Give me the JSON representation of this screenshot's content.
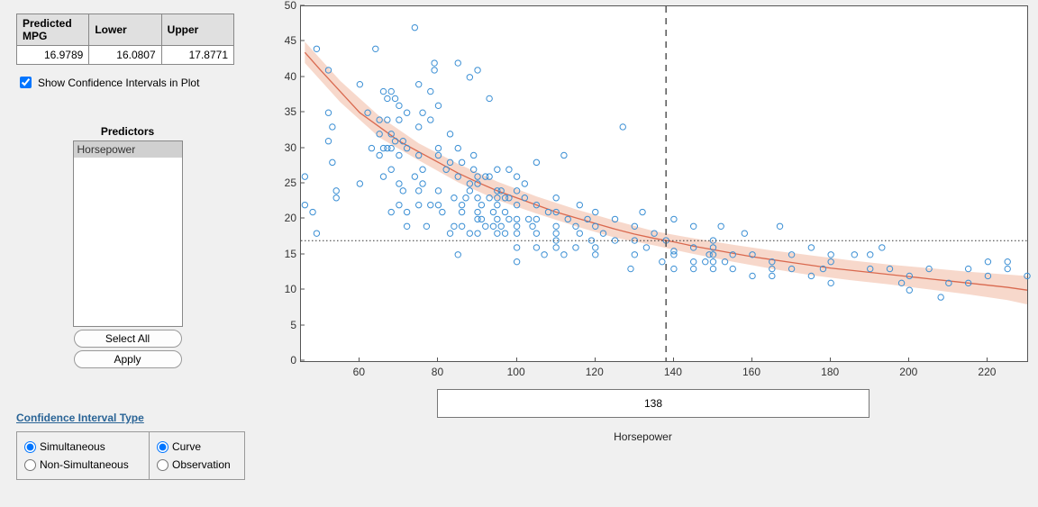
{
  "table": {
    "headers": [
      "Predicted MPG",
      "Lower",
      "Upper"
    ],
    "values": [
      "16.9789",
      "16.0807",
      "17.8771"
    ]
  },
  "checkbox": {
    "label": "Show Confidence Intervals in Plot",
    "checked": true
  },
  "predictors": {
    "title": "Predictors",
    "items": [
      "Horsepower"
    ],
    "selected": 0,
    "select_all": "Select All",
    "apply": "Apply"
  },
  "ci": {
    "link": "Confidence Interval Type",
    "col1": [
      {
        "label": "Simultaneous",
        "checked": true
      },
      {
        "label": "Non-Simultaneous",
        "checked": false
      }
    ],
    "col2": [
      {
        "label": "Curve",
        "checked": true
      },
      {
        "label": "Observation",
        "checked": false
      }
    ]
  },
  "slider": {
    "value": "138",
    "axis_label": "Horsepower"
  },
  "chart_data": {
    "type": "scatter",
    "xlabel": "Horsepower",
    "ylabel": "",
    "xlim": [
      45,
      230
    ],
    "ylim": [
      0,
      50
    ],
    "xticks": [
      60,
      80,
      100,
      120,
      140,
      160,
      180,
      200,
      220
    ],
    "yticks": [
      0,
      5,
      10,
      15,
      20,
      25,
      30,
      35,
      40,
      45,
      50
    ],
    "vertical_line_x": 138,
    "horizontal_line_y": 16.98,
    "fit_curve": [
      [
        46,
        43.5
      ],
      [
        50,
        41
      ],
      [
        55,
        38
      ],
      [
        60,
        35
      ],
      [
        65,
        33
      ],
      [
        70,
        31
      ],
      [
        75,
        29.5
      ],
      [
        80,
        28
      ],
      [
        85,
        26.5
      ],
      [
        90,
        25.2
      ],
      [
        95,
        24
      ],
      [
        100,
        23
      ],
      [
        105,
        22
      ],
      [
        110,
        21
      ],
      [
        115,
        20.2
      ],
      [
        120,
        19.4
      ],
      [
        125,
        18.6
      ],
      [
        130,
        17.9
      ],
      [
        135,
        17.3
      ],
      [
        140,
        16.8
      ],
      [
        145,
        16.2
      ],
      [
        150,
        15.7
      ],
      [
        155,
        15.2
      ],
      [
        160,
        14.7
      ],
      [
        165,
        14.3
      ],
      [
        170,
        13.9
      ],
      [
        175,
        13.5
      ],
      [
        180,
        13.1
      ],
      [
        185,
        12.8
      ],
      [
        190,
        12.5
      ],
      [
        195,
        12.2
      ],
      [
        200,
        11.9
      ],
      [
        205,
        11.6
      ],
      [
        210,
        11.3
      ],
      [
        215,
        11.0
      ],
      [
        220,
        10.7
      ],
      [
        225,
        10.4
      ],
      [
        230,
        10.0
      ]
    ],
    "ci_upper": [
      [
        46,
        45
      ],
      [
        55,
        39.5
      ],
      [
        65,
        34.5
      ],
      [
        75,
        30.7
      ],
      [
        85,
        27.8
      ],
      [
        95,
        25.3
      ],
      [
        105,
        23.2
      ],
      [
        115,
        21.4
      ],
      [
        125,
        19.8
      ],
      [
        135,
        18.3
      ],
      [
        145,
        17.3
      ],
      [
        155,
        16.4
      ],
      [
        165,
        15.6
      ],
      [
        175,
        14.9
      ],
      [
        185,
        14.2
      ],
      [
        195,
        13.6
      ],
      [
        205,
        13.1
      ],
      [
        215,
        12.6
      ],
      [
        225,
        12.2
      ],
      [
        230,
        12.0
      ]
    ],
    "ci_lower": [
      [
        46,
        42
      ],
      [
        55,
        36.5
      ],
      [
        65,
        31.5
      ],
      [
        75,
        28.3
      ],
      [
        85,
        25.2
      ],
      [
        95,
        22.7
      ],
      [
        105,
        20.8
      ],
      [
        115,
        19.0
      ],
      [
        125,
        17.4
      ],
      [
        135,
        16.3
      ],
      [
        145,
        15.1
      ],
      [
        155,
        14.0
      ],
      [
        165,
        13.0
      ],
      [
        175,
        12.1
      ],
      [
        185,
        11.4
      ],
      [
        195,
        10.8
      ],
      [
        205,
        10.1
      ],
      [
        215,
        9.4
      ],
      [
        225,
        8.6
      ],
      [
        230,
        8.0
      ]
    ],
    "points": [
      [
        46,
        26
      ],
      [
        46,
        22
      ],
      [
        48,
        21
      ],
      [
        49,
        18
      ],
      [
        49,
        44
      ],
      [
        52,
        35
      ],
      [
        52,
        31
      ],
      [
        52,
        41
      ],
      [
        53,
        28
      ],
      [
        53,
        33
      ],
      [
        54,
        24
      ],
      [
        54,
        23
      ],
      [
        60,
        25
      ],
      [
        60,
        39
      ],
      [
        62,
        35
      ],
      [
        63,
        30
      ],
      [
        64,
        44
      ],
      [
        65,
        29
      ],
      [
        65,
        34
      ],
      [
        65,
        32
      ],
      [
        66,
        30
      ],
      [
        66,
        38
      ],
      [
        66,
        26
      ],
      [
        67,
        30
      ],
      [
        67,
        34
      ],
      [
        67,
        37
      ],
      [
        68,
        21
      ],
      [
        68,
        38
      ],
      [
        68,
        27
      ],
      [
        68,
        32
      ],
      [
        68,
        30
      ],
      [
        69,
        37
      ],
      [
        69,
        31
      ],
      [
        70,
        25
      ],
      [
        70,
        36
      ],
      [
        70,
        29
      ],
      [
        70,
        22
      ],
      [
        70,
        34
      ],
      [
        71,
        24
      ],
      [
        71,
        31
      ],
      [
        72,
        19
      ],
      [
        72,
        21
      ],
      [
        72,
        35
      ],
      [
        72,
        30
      ],
      [
        74,
        26
      ],
      [
        74,
        47
      ],
      [
        75,
        24
      ],
      [
        75,
        22
      ],
      [
        75,
        39
      ],
      [
        75,
        33
      ],
      [
        75,
        29
      ],
      [
        76,
        25
      ],
      [
        76,
        35
      ],
      [
        76,
        27
      ],
      [
        77,
        19
      ],
      [
        78,
        38
      ],
      [
        78,
        22
      ],
      [
        78,
        34
      ],
      [
        79,
        41
      ],
      [
        79,
        42
      ],
      [
        80,
        22
      ],
      [
        80,
        30
      ],
      [
        80,
        29
      ],
      [
        80,
        24
      ],
      [
        80,
        36
      ],
      [
        81,
        21
      ],
      [
        82,
        27
      ],
      [
        83,
        32
      ],
      [
        83,
        18
      ],
      [
        83,
        28
      ],
      [
        84,
        23
      ],
      [
        84,
        19
      ],
      [
        85,
        26
      ],
      [
        85,
        42
      ],
      [
        85,
        30
      ],
      [
        85,
        15
      ],
      [
        86,
        28
      ],
      [
        86,
        19
      ],
      [
        86,
        21
      ],
      [
        86,
        22
      ],
      [
        87,
        23
      ],
      [
        88,
        24
      ],
      [
        88,
        18
      ],
      [
        88,
        40
      ],
      [
        88,
        25
      ],
      [
        89,
        29
      ],
      [
        89,
        27
      ],
      [
        90,
        21
      ],
      [
        90,
        18
      ],
      [
        90,
        41
      ],
      [
        90,
        26
      ],
      [
        90,
        25
      ],
      [
        90,
        20
      ],
      [
        90,
        23
      ],
      [
        91,
        22
      ],
      [
        91,
        20
      ],
      [
        92,
        26
      ],
      [
        92,
        19
      ],
      [
        93,
        26
      ],
      [
        93,
        23
      ],
      [
        93,
        37
      ],
      [
        94,
        21
      ],
      [
        94,
        19
      ],
      [
        95,
        23
      ],
      [
        95,
        27
      ],
      [
        95,
        20
      ],
      [
        95,
        22
      ],
      [
        95,
        24
      ],
      [
        95,
        18
      ],
      [
        96,
        19
      ],
      [
        96,
        24
      ],
      [
        97,
        18
      ],
      [
        97,
        23
      ],
      [
        97,
        21
      ],
      [
        98,
        27
      ],
      [
        98,
        20
      ],
      [
        98,
        23
      ],
      [
        100,
        19
      ],
      [
        100,
        24
      ],
      [
        100,
        22
      ],
      [
        100,
        20
      ],
      [
        100,
        18
      ],
      [
        100,
        14
      ],
      [
        100,
        16
      ],
      [
        100,
        26
      ],
      [
        102,
        25
      ],
      [
        102,
        23
      ],
      [
        103,
        20
      ],
      [
        104,
        19
      ],
      [
        105,
        18
      ],
      [
        105,
        22
      ],
      [
        105,
        28
      ],
      [
        105,
        20
      ],
      [
        105,
        16
      ],
      [
        107,
        15
      ],
      [
        108,
        21
      ],
      [
        110,
        19
      ],
      [
        110,
        21
      ],
      [
        110,
        17
      ],
      [
        110,
        23
      ],
      [
        110,
        18
      ],
      [
        110,
        16
      ],
      [
        112,
        15
      ],
      [
        112,
        29
      ],
      [
        113,
        20
      ],
      [
        115,
        19
      ],
      [
        115,
        16
      ],
      [
        116,
        18
      ],
      [
        116,
        22
      ],
      [
        118,
        20
      ],
      [
        119,
        17
      ],
      [
        120,
        15
      ],
      [
        120,
        16
      ],
      [
        120,
        21
      ],
      [
        120,
        19
      ],
      [
        122,
        18
      ],
      [
        125,
        17
      ],
      [
        125,
        20
      ],
      [
        127,
        33
      ],
      [
        129,
        13
      ],
      [
        130,
        15
      ],
      [
        130,
        17
      ],
      [
        130,
        19
      ],
      [
        132,
        21
      ],
      [
        133,
        16
      ],
      [
        135,
        18
      ],
      [
        137,
        14
      ],
      [
        138,
        17
      ],
      [
        140,
        15
      ],
      [
        140,
        20
      ],
      [
        140,
        13
      ],
      [
        140,
        15.5
      ],
      [
        145,
        13
      ],
      [
        145,
        16
      ],
      [
        145,
        19
      ],
      [
        145,
        14
      ],
      [
        148,
        14
      ],
      [
        149,
        15
      ],
      [
        150,
        13
      ],
      [
        150,
        14
      ],
      [
        150,
        17
      ],
      [
        150,
        15
      ],
      [
        150,
        16
      ],
      [
        152,
        19
      ],
      [
        153,
        14
      ],
      [
        155,
        15
      ],
      [
        155,
        13
      ],
      [
        158,
        18
      ],
      [
        160,
        12
      ],
      [
        160,
        15
      ],
      [
        165,
        14
      ],
      [
        165,
        13
      ],
      [
        165,
        12
      ],
      [
        167,
        19
      ],
      [
        170,
        15
      ],
      [
        170,
        13
      ],
      [
        175,
        12
      ],
      [
        175,
        16
      ],
      [
        178,
        13
      ],
      [
        180,
        11
      ],
      [
        180,
        14
      ],
      [
        180,
        15
      ],
      [
        186,
        15
      ],
      [
        190,
        13
      ],
      [
        190,
        15
      ],
      [
        193,
        16
      ],
      [
        195,
        13
      ],
      [
        198,
        11
      ],
      [
        200,
        12
      ],
      [
        200,
        10
      ],
      [
        205,
        13
      ],
      [
        208,
        9
      ],
      [
        210,
        11
      ],
      [
        215,
        13
      ],
      [
        215,
        11
      ],
      [
        220,
        14
      ],
      [
        220,
        12
      ],
      [
        225,
        14
      ],
      [
        225,
        13
      ],
      [
        230,
        12
      ]
    ]
  }
}
